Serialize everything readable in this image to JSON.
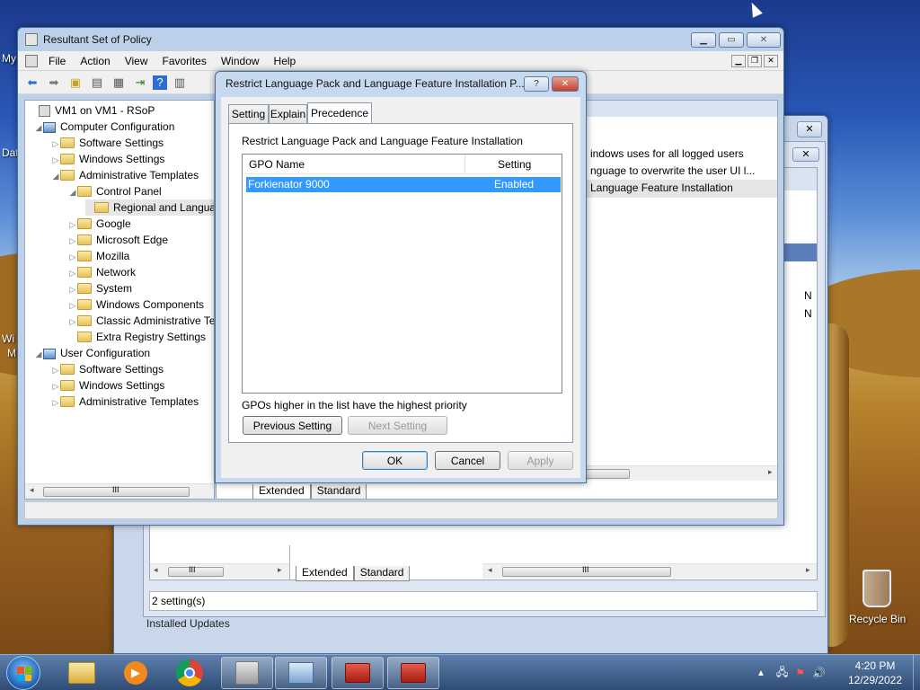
{
  "desktop": {
    "recycle_bin_label": "Recycle Bin",
    "icon_labels_left": [
      "My",
      "Dat",
      "Wi",
      "M"
    ]
  },
  "back_window": {
    "scroll_thumb_label": "III",
    "tabs": [
      "Extended",
      "Standard"
    ],
    "status": "2 setting(s)",
    "below_text": "Installed Updates",
    "peek_text": "N"
  },
  "rsop_window": {
    "title": "Resultant Set of Policy",
    "menu": [
      "File",
      "Action",
      "View",
      "Favorites",
      "Window",
      "Help"
    ],
    "tree": [
      {
        "label": "VM1 on VM1 - RSoP",
        "level": 0,
        "arrow": ""
      },
      {
        "label": "Computer Configuration",
        "level": 1,
        "arrow": "◢"
      },
      {
        "label": "Software Settings",
        "level": 2,
        "arrow": "▷"
      },
      {
        "label": "Windows Settings",
        "level": 2,
        "arrow": "▷"
      },
      {
        "label": "Administrative Templates",
        "level": 2,
        "arrow": "◢"
      },
      {
        "label": "Control Panel",
        "level": 3,
        "arrow": "◢"
      },
      {
        "label": "Regional and Langua",
        "level": 4,
        "arrow": ""
      },
      {
        "label": "Google",
        "level": 3,
        "arrow": "▷"
      },
      {
        "label": "Microsoft Edge",
        "level": 3,
        "arrow": "▷"
      },
      {
        "label": "Mozilla",
        "level": 3,
        "arrow": "▷"
      },
      {
        "label": "Network",
        "level": 3,
        "arrow": "▷"
      },
      {
        "label": "System",
        "level": 3,
        "arrow": "▷"
      },
      {
        "label": "Windows Components",
        "level": 3,
        "arrow": "▷"
      },
      {
        "label": "Classic Administrative Te",
        "level": 3,
        "arrow": "▷"
      },
      {
        "label": "Extra Registry Settings",
        "level": 3,
        "arrow": ""
      },
      {
        "label": "User Configuration",
        "level": 1,
        "arrow": "◢"
      },
      {
        "label": "Software Settings",
        "level": 2,
        "arrow": "▷"
      },
      {
        "label": "Windows Settings",
        "level": 2,
        "arrow": "▷"
      },
      {
        "label": "Administrative Templates",
        "level": 2,
        "arrow": "▷"
      }
    ],
    "right_rows": [
      "indows uses for all logged users",
      "nguage to overwrite the user UI l...",
      "Language Feature Installation"
    ],
    "scroll_thumb_label": "III",
    "tabs": [
      "Extended",
      "Standard"
    ]
  },
  "dialog": {
    "title": "Restrict Language Pack and Language Feature Installation P...",
    "help_label": "?",
    "tabs": [
      "Setting",
      "Explain",
      "Precedence"
    ],
    "policy_name": "Restrict Language Pack and Language Feature Installation",
    "columns": [
      "GPO Name",
      "Setting"
    ],
    "rows": [
      {
        "gpo": "Forkienator 9000",
        "setting": "Enabled"
      }
    ],
    "priority_note": "GPOs higher in the list have the highest priority",
    "previous_label": "Previous Setting",
    "next_label": "Next Setting",
    "ok_label": "OK",
    "cancel_label": "Cancel",
    "apply_label": "Apply"
  },
  "taskbar": {
    "time": "4:20 PM",
    "date": "12/29/2022"
  },
  "colors": {
    "selection": "#3399ff",
    "close_red": "#c2402b",
    "taskbar": "#2f4c74"
  }
}
